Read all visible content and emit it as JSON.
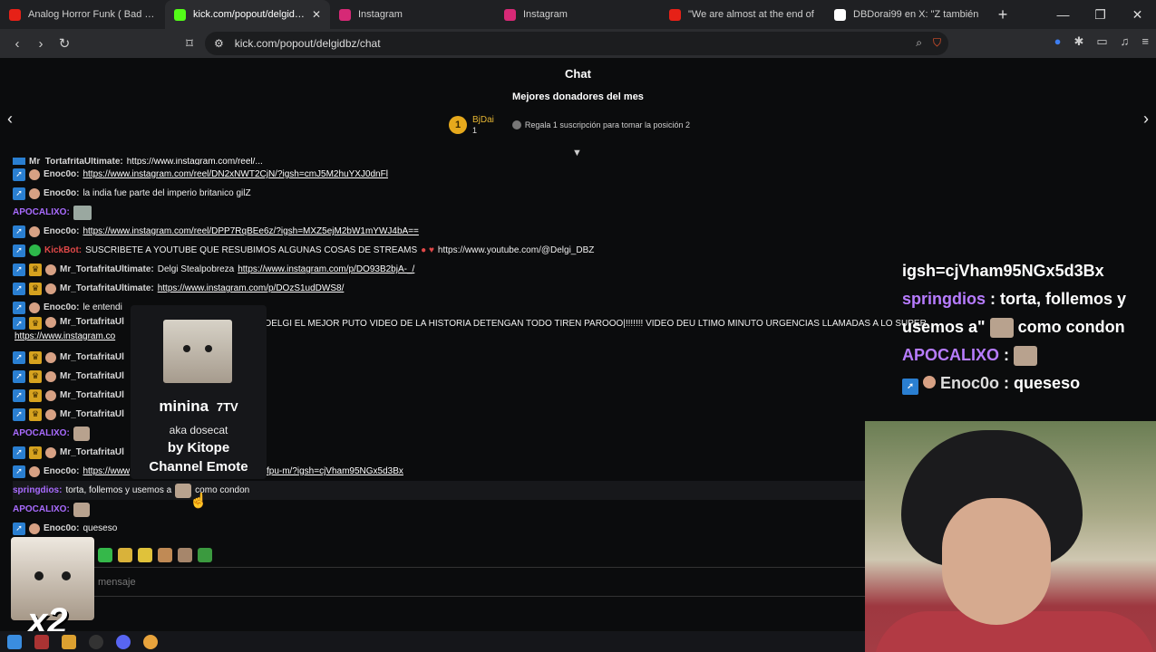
{
  "browser": {
    "tabs": [
      {
        "title": "Analog Horror Funk ( Bad Ha",
        "favicon_color": "#e62117",
        "active": false
      },
      {
        "title": "kick.com/popout/delgidbz",
        "favicon_color": "#53fc18",
        "active": true
      },
      {
        "title": "Instagram",
        "favicon_color": "#d62976",
        "active": false
      },
      {
        "title": "Instagram",
        "favicon_color": "#d62976",
        "active": false
      },
      {
        "title": "\"We are almost at the end of",
        "favicon_color": "#e62117",
        "active": false
      },
      {
        "title": "DBDorai99 en X: \"Z también",
        "favicon_color": "#ffffff",
        "active": false
      }
    ],
    "new_tab_icon": "plus-icon",
    "url": "kick.com/popout/delgidbz/chat"
  },
  "chat": {
    "title": "Chat",
    "donors_title": "Mejores donadores del mes",
    "top_donor": {
      "rank": "1",
      "name": "BjDai",
      "count": "1"
    },
    "donor_hint": "Regala 1 suscripción para tomar la posición 2",
    "input_placeholder": "mensaje",
    "messages": [
      {
        "user": "Mr_TortafritaUltimate:",
        "text": "https://www.instagram.com/reel/...",
        "cut": true
      },
      {
        "user": "Enoc0o:",
        "link": "https://www.instagram.com/reel/DN2xNWT2CjN/?igsh=cmJ5M2huYXJ0dnFl"
      },
      {
        "user": "Enoc0o:",
        "text": "la india fue parte del imperio britanico gilZ"
      },
      {
        "user": "APOCALIXO:",
        "text": ""
      },
      {
        "user": "Enoc0o:",
        "link": "https://www.instagram.com/reel/DPP7RqBEe6z/?igsh=MXZ5ejM2bW1mYWJ4bA=="
      },
      {
        "user": "KickBot:",
        "text": "SUSCRIBETE A YOUTUBE QUE RESUBIMOS ALGUNAS COSAS DE STREAMS",
        "link2": "https://www.youtube.com/@Delgi_DBZ"
      },
      {
        "user": "Mr_TortafritaUltimate:",
        "text": "Delgi Stealpobreza",
        "link": "https://www.instagram.com/p/DO93B2bjA-_/"
      },
      {
        "user": "Mr_TortafritaUltimate:",
        "link": "https://www.instagram.com/p/DOzS1udDWS8/"
      },
      {
        "user": "Enoc0o:",
        "text": "le entendi"
      },
      {
        "user": "Mr_TortafritaUl",
        "text": "DELGI EL MEJOR PUTO VIDEO DE LA HISTORIA DETENGAN TODO TIREN PAROOO|!!!!!!! VIDEO DEU LTIMO MINUTO URGENCIAS LLAMADAS A LO SUPER",
        "link": "https://www.instagram.co"
      },
      {
        "user": "Mr_TortafritaUl",
        "text": ""
      },
      {
        "user": "Mr_TortafritaUl",
        "text": ""
      },
      {
        "user": "Mr_TortafritaUl",
        "text": ""
      },
      {
        "user": "Mr_TortafritaUl",
        "text": ""
      },
      {
        "user": "APOCALIXO:",
        "text": ""
      },
      {
        "user": "Mr_TortafritaUl",
        "text": ""
      },
      {
        "user": "Enoc0o:",
        "link": "https://www",
        "link_end": "fpu-m/?igsh=cjVham95NGx5d3Bx"
      },
      {
        "user": "springdios:",
        "text": "torta, follemos y usemos a",
        "text2": "como condon"
      },
      {
        "user": "APOCALIXO:",
        "text": ""
      },
      {
        "user": "Enoc0o:",
        "text": "queseso"
      }
    ]
  },
  "tooltip": {
    "emote_name": "minina",
    "badge": "7TV",
    "aka": "aka dosecat",
    "by": "by Kitope",
    "type": "Channel Emote"
  },
  "overlay": {
    "line1": "igsh=cjVham95NGx5d3Bx",
    "line2_user": "springdios",
    "line2_text": " : torta, follemos y",
    "line3_text": "usemos a\"",
    "line3_text2": " como condon",
    "line4_user": "APOCALIXO",
    "line4_sep": " :",
    "line5_user": "Enoc0o",
    "line5_text": " : queseso"
  },
  "stream": {
    "multiplier": "x2"
  },
  "colors": {
    "kick_green": "#53fc18",
    "username_purple": "#a96bff",
    "gold": "#e6a91c"
  }
}
